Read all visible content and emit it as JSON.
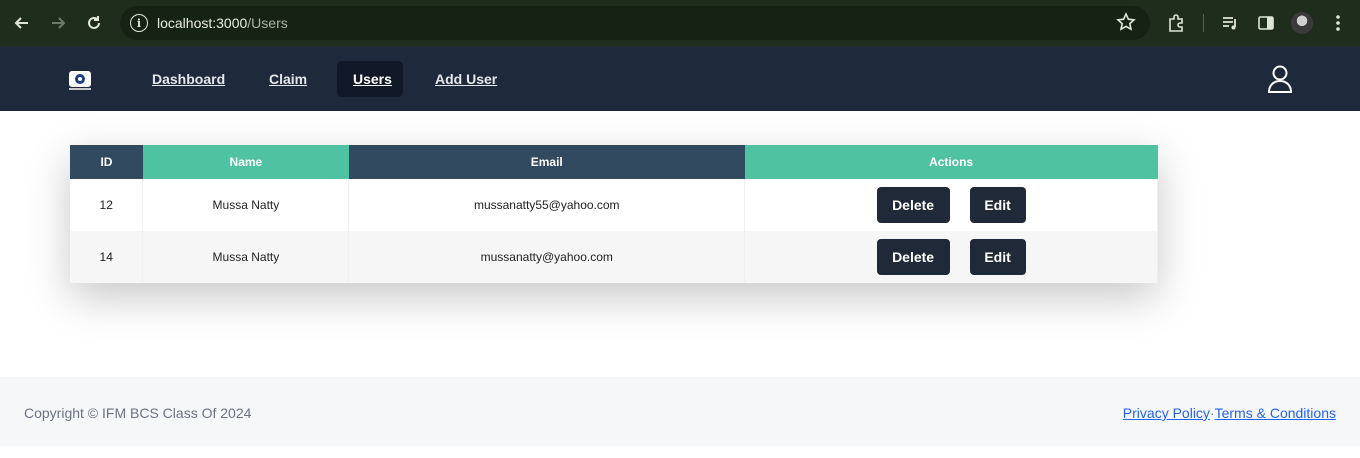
{
  "browser": {
    "url_host": "localhost:3000",
    "url_path": "/Users"
  },
  "navbar": {
    "links": [
      "Dashboard",
      "Claim",
      "Users",
      "Add User"
    ],
    "active": "Users"
  },
  "table": {
    "headers": [
      "ID",
      "Name",
      "Email",
      "Actions"
    ],
    "rows": [
      {
        "id": "12",
        "name": "Mussa Natty",
        "email": "mussanatty55@yahoo.com"
      },
      {
        "id": "14",
        "name": "Mussa Natty",
        "email": "mussanatty@yahoo.com"
      }
    ],
    "delete_label": "Delete",
    "edit_label": "Edit"
  },
  "footer": {
    "copyright": "Copyright © IFM BCS Class Of 2024",
    "privacy": "Privacy Policy",
    "separator": "·",
    "terms": "Terms & Conditions"
  },
  "colors": {
    "navbar": "#1e293b",
    "header_dark": "#324a5f",
    "header_green": "#4fc3a1",
    "button": "#1f2937"
  }
}
